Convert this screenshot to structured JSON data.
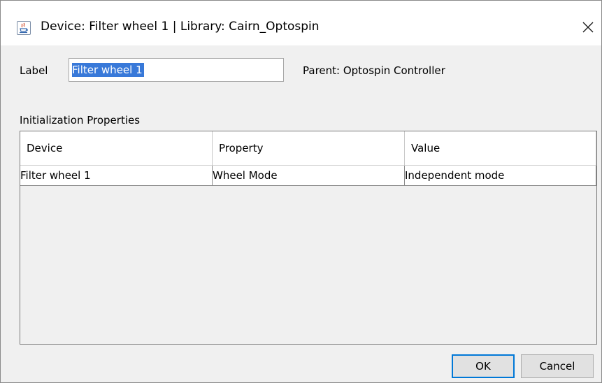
{
  "window": {
    "title": "Device: Filter wheel 1 | Library: Cairn_Optospin",
    "app_icon": "java-cup-icon",
    "close_icon": "close-icon"
  },
  "form": {
    "label_caption": "Label",
    "label_value": "Filter wheel 1",
    "parent_text": "Parent: Optospin Controller"
  },
  "init_properties": {
    "section_title": "Initialization Properties",
    "columns": [
      "Device",
      "Property",
      "Value"
    ],
    "rows": [
      [
        "Filter wheel 1",
        "Wheel Mode",
        "Independent mode"
      ]
    ]
  },
  "buttons": {
    "ok": "OK",
    "cancel": "Cancel"
  },
  "colors": {
    "selection": "#3879d9",
    "default_button_border": "#0078d7",
    "dialog_background": "#f0f0f0"
  }
}
